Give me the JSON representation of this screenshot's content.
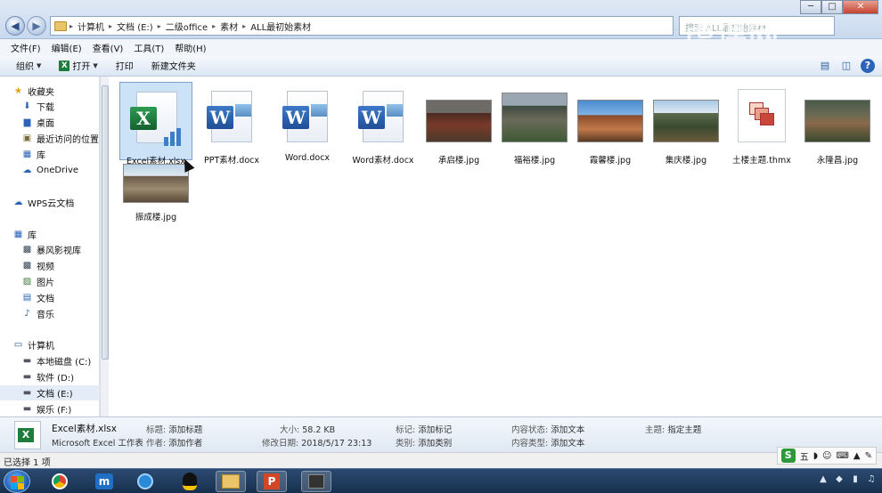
{
  "address": {
    "crumbs": [
      "计算机",
      "文档 (E:)",
      "二级office",
      "素材",
      "ALL最初始素材"
    ],
    "search_placeholder": "搜索 ALL最初始素材"
  },
  "window_controls": [
    "─",
    "□",
    "✕"
  ],
  "menu": [
    "文件(F)",
    "编辑(E)",
    "查看(V)",
    "工具(T)",
    "帮助(H)"
  ],
  "toolbar": {
    "organize": "组织",
    "open": "打开",
    "print": "打印",
    "new_folder": "新建文件夹"
  },
  "nav": {
    "favorites_label": "收藏夹",
    "favorites": [
      "下载",
      "桌面",
      "最近访问的位置",
      "库",
      "OneDrive"
    ],
    "wps": "WPS云文档",
    "library_label": "库",
    "libraries": [
      "暴风影视库",
      "视频",
      "图片",
      "文档",
      "音乐"
    ],
    "computer_label": "计算机",
    "drives": [
      "本地磁盘 (C:)",
      "软件 (D:)",
      "文档 (E:)",
      "娱乐 (F:)"
    ]
  },
  "files": [
    {
      "name": "Excel素材.xlsx",
      "type": "excel",
      "selected": true
    },
    {
      "name": "PPT素材.docx",
      "type": "word"
    },
    {
      "name": "Word.docx",
      "type": "word"
    },
    {
      "name": "Word素材.docx",
      "type": "word"
    },
    {
      "name": "承启楼.jpg",
      "type": "photo"
    },
    {
      "name": "福裕楼.jpg",
      "type": "photo"
    },
    {
      "name": "霞馨楼.jpg",
      "type": "photo"
    },
    {
      "name": "集庆楼.jpg",
      "type": "photo"
    },
    {
      "name": "土楼主题.thmx",
      "type": "thmx"
    },
    {
      "name": "永隆昌.jpg",
      "type": "photo"
    },
    {
      "name": "振成楼.jpg",
      "type": "photo"
    }
  ],
  "details": {
    "filename": "Excel素材.xlsx",
    "filetype": "Microsoft Excel 工作表",
    "title_k": "标题:",
    "title_v": "添加标题",
    "author_k": "作者:",
    "author_v": "添加作者",
    "size_k": "大小:",
    "size_v": "58.2 KB",
    "modified_k": "修改日期:",
    "modified_v": "2018/5/17 23:13",
    "tags_k": "标记:",
    "tags_v": "添加标记",
    "category_k": "类别:",
    "category_v": "添加类别",
    "status_k": "内容状态:",
    "status_v": "添加文本",
    "ctype_k": "内容类型:",
    "ctype_v": "添加文本",
    "subject_k": "主题:",
    "subject_v": "指定主题"
  },
  "statusbar": "已选择 1 项",
  "ime": {
    "logo": "S",
    "mode": "五"
  },
  "watermark": "虎课网"
}
